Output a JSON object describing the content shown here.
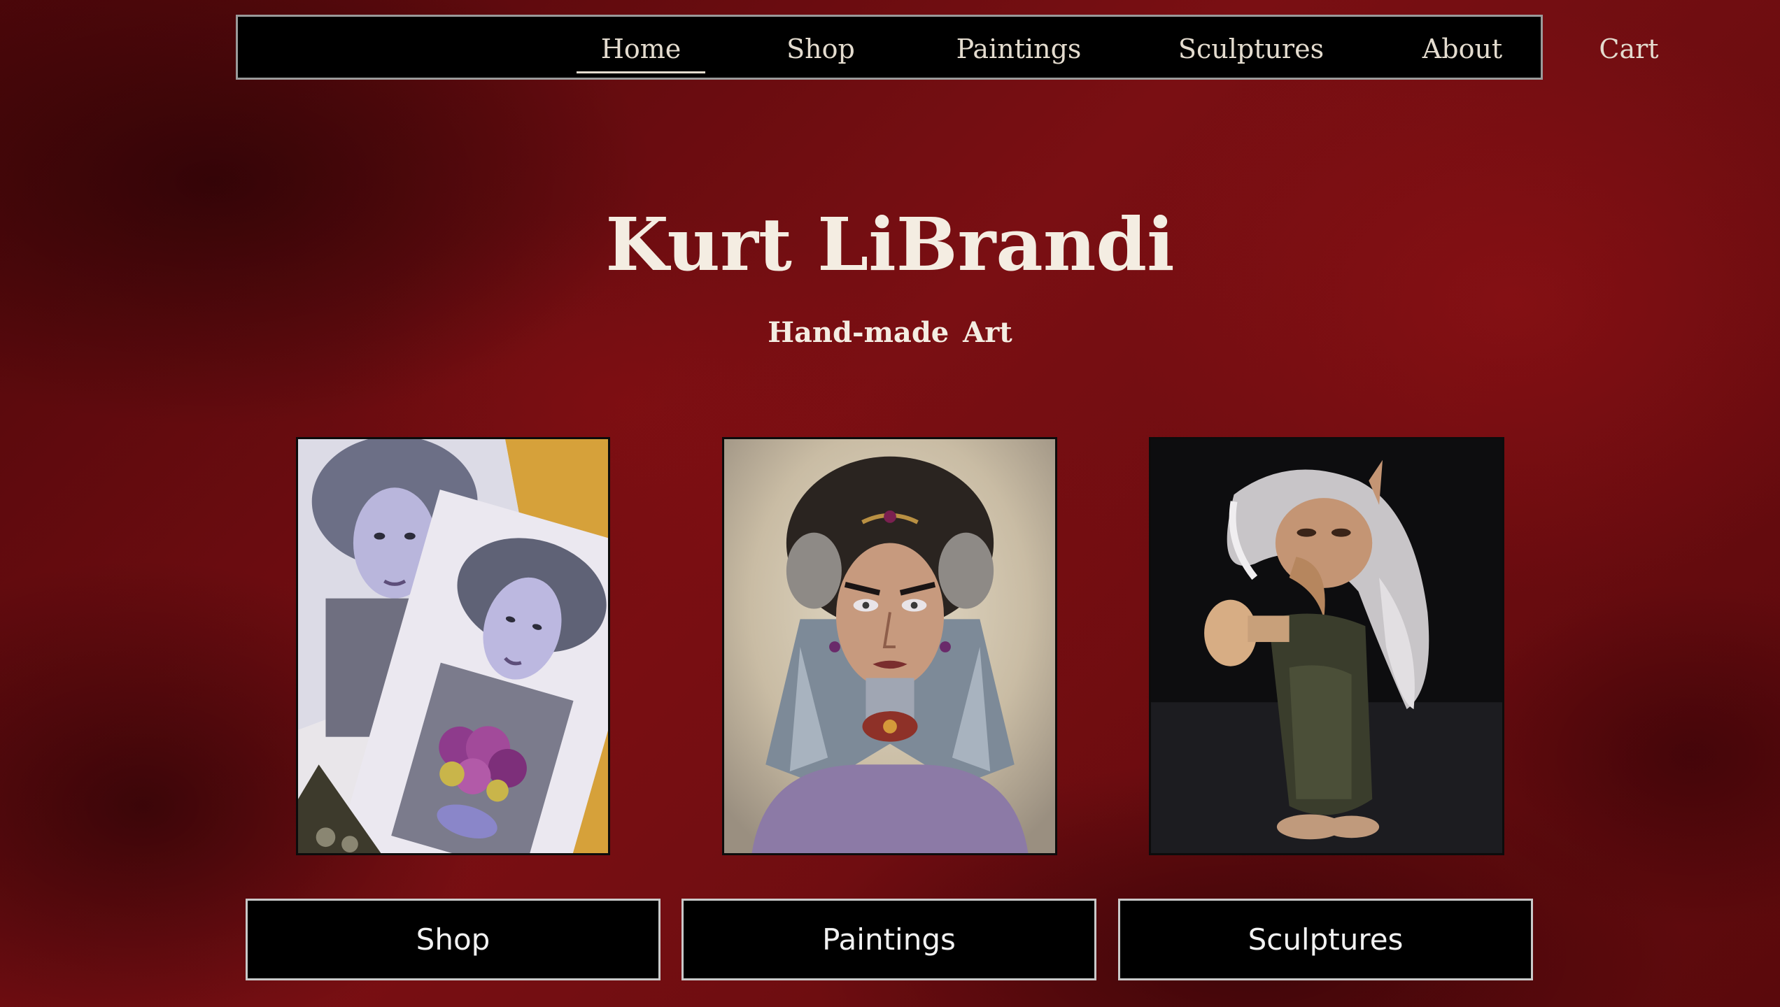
{
  "nav": {
    "items": [
      {
        "label": "Home",
        "active": true
      },
      {
        "label": "Shop",
        "active": false
      },
      {
        "label": "Paintings",
        "active": false
      },
      {
        "label": "Sculptures",
        "active": false
      },
      {
        "label": "About",
        "active": false
      },
      {
        "label": "Cart",
        "active": false
      }
    ]
  },
  "hero": {
    "title": "Kurt LiBrandi",
    "subtitle": "Hand-made Art"
  },
  "gallery": {
    "images": [
      {
        "subject": "pale woman with grey hair holding purple bouquet, painting prints"
      },
      {
        "subject": "stern woman with dark hair, jeweled circlet and grey hood, watercolor"
      },
      {
        "subject": "sculpted gnome with long white hair and beak nose on black backdrop"
      }
    ]
  },
  "cta": {
    "buttons": [
      {
        "label": "Shop"
      },
      {
        "label": "Paintings"
      },
      {
        "label": "Sculptures"
      }
    ]
  },
  "colors": {
    "background": "#6a0c10",
    "nav_bg": "#000000",
    "text": "#f4ede2",
    "button_border": "#c9c9c9"
  }
}
